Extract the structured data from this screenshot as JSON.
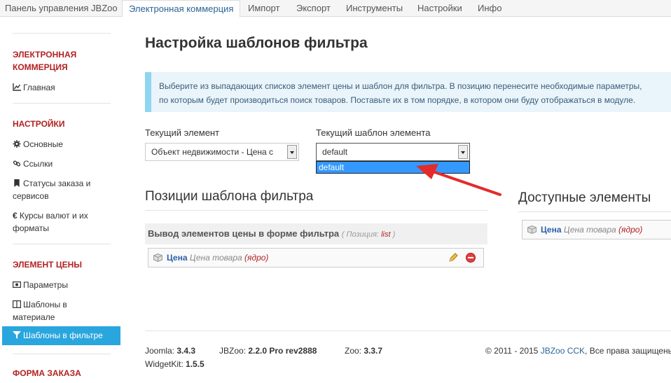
{
  "tabs": [
    {
      "label": "Панель управления JBZoo",
      "active": false
    },
    {
      "label": "Электронная коммерция",
      "active": true
    },
    {
      "label": "Импорт",
      "active": false
    },
    {
      "label": "Экспорт",
      "active": false
    },
    {
      "label": "Инструменты",
      "active": false
    },
    {
      "label": "Настройки",
      "active": false
    },
    {
      "label": "Инфо",
      "active": false
    }
  ],
  "sidebar": {
    "ecommerce_heading": "ЭЛЕКТРОННАЯ КОММЕРЦИЯ",
    "home": "Главная",
    "settings_heading": "НАСТРОЙКИ",
    "basic": "Основные",
    "links": "Ссылки",
    "statuses": "Статусы заказа и сервисов",
    "currency": "Курсы валют и их форматы",
    "price_heading": "ЭЛЕМЕНТ ЦЕНЫ",
    "params": "Параметры",
    "templates_material": "Шаблоны в материале",
    "templates_filter": "Шаблоны в фильтре",
    "order_heading": "ФОРМА ЗАКАЗА"
  },
  "page": {
    "title": "Настройка шаблонов фильтра",
    "info_line1": "Выберите из выпадающих списков элемент цены и шаблон для фильтра. В позицию перенесите необходимые параметры,",
    "info_line2": "по которым будет производиться поиск товаров. Поставьте их в том порядке, в котором они буду отображаться в модуле."
  },
  "form": {
    "current_element_label": "Текущий элемент",
    "current_element_value": "Объект недвижимости - Цена с",
    "current_template_label": "Текущий шаблон элемента",
    "current_template_value": "default",
    "dropdown_option": "default"
  },
  "positions": {
    "heading": "Позиции шаблона фильтра",
    "box_title": "Вывод элементов цены в форме фильтра",
    "box_meta_prefix": "( Позиция: ",
    "box_meta_value": "list",
    "box_meta_suffix": " )",
    "element_name": "Цена",
    "element_type": "Цена товара",
    "element_core": "(ядро)"
  },
  "available": {
    "heading": "Доступные элементы",
    "element_name": "Цена",
    "element_type": "Цена товара",
    "element_core": "(ядро)"
  },
  "footer": {
    "joomla_label": "Joomla:",
    "joomla_version": "3.4.3",
    "jbzoo_label": "JBZoo:",
    "jbzoo_version": "2.2.0 Pro rev2888",
    "zoo_label": "Zoo:",
    "zoo_version": "3.3.7",
    "widgetkit_label": "WidgetKit:",
    "widgetkit_version": "1.5.5",
    "copyright_prefix": "© 2011 - 2015 ",
    "copyright_link": "JBZoo CCK",
    "copyright_suffix": ", Все права защищены"
  },
  "colors": {
    "accent": "#2aa6de",
    "heading_red": "#b22222",
    "annotation_arrow": "#e52a2a"
  }
}
